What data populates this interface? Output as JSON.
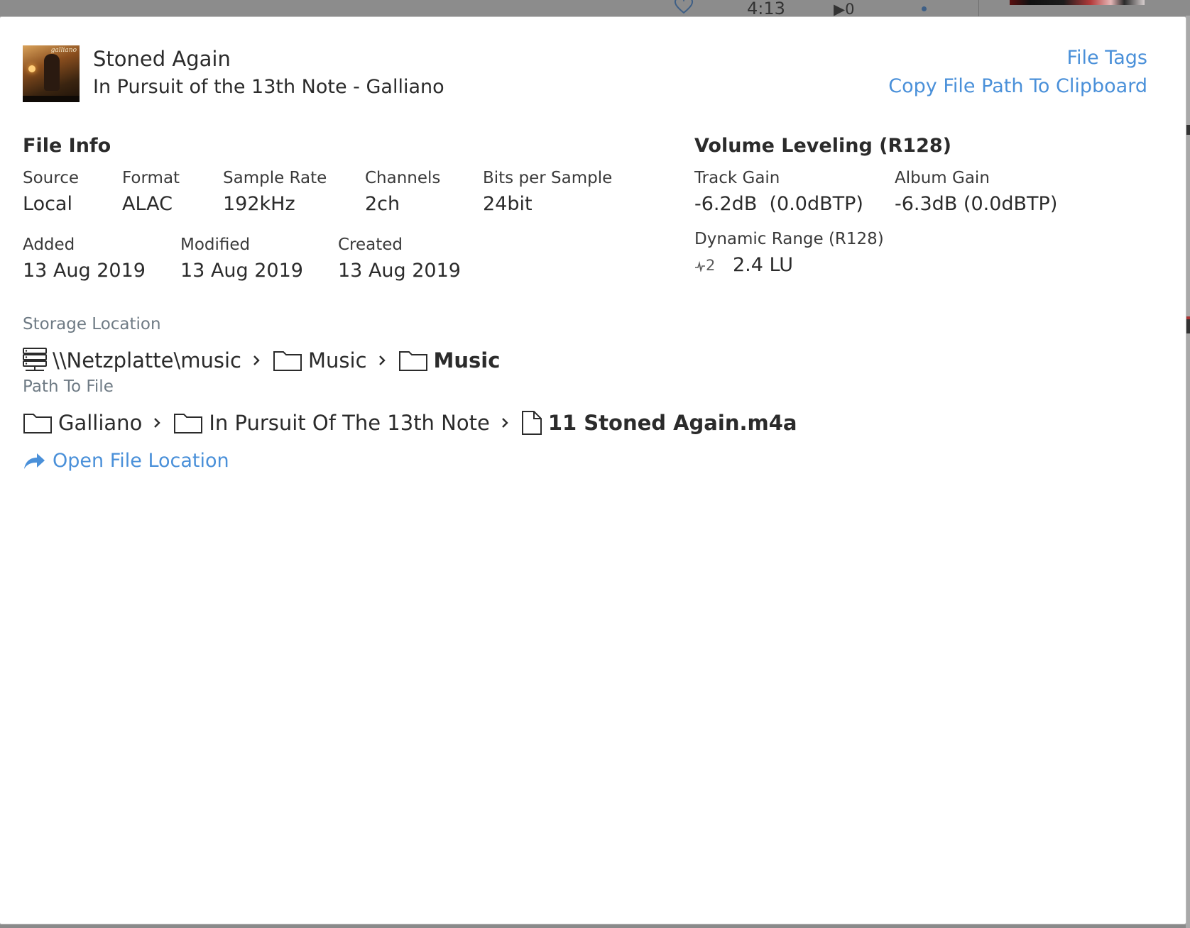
{
  "background_player": {
    "time": "4:13",
    "play_count": "0"
  },
  "header": {
    "title": "Stoned Again",
    "subtitle": "In Pursuit of the 13th Note - Galliano",
    "cover_logo": "galliano",
    "actions": {
      "file_tags": "File Tags",
      "copy_path": "Copy File Path To Clipboard"
    }
  },
  "file_info": {
    "title": "File Info",
    "source_label": "Source",
    "source_value": "Local",
    "format_label": "Format",
    "format_value": "ALAC",
    "sample_rate_label": "Sample Rate",
    "sample_rate_value": "192kHz",
    "channels_label": "Channels",
    "channels_value": "2ch",
    "bits_label": "Bits per Sample",
    "bits_value": "24bit",
    "added_label": "Added",
    "added_value": "13 Aug 2019",
    "modified_label": "Modified",
    "modified_value": "13 Aug 2019",
    "created_label": "Created",
    "created_value": "13 Aug 2019"
  },
  "volume_leveling": {
    "title": "Volume Leveling (R128)",
    "track_gain_label": "Track Gain",
    "track_gain_value": "-6.2dB  (0.0dBTP)",
    "album_gain_label": "Album Gain",
    "album_gain_value": "-6.3dB (0.0dBTP)",
    "dynamic_range_label": "Dynamic Range (R128)",
    "dynamic_range_badge": "2",
    "dynamic_range_value": "2.4 LU"
  },
  "storage": {
    "label": "Storage Location",
    "crumbs": [
      "\\\\Netzplatte\\music",
      "Music",
      "Music"
    ]
  },
  "path": {
    "label": "Path To File",
    "crumbs": [
      "Galliano",
      "In Pursuit Of The 13th Note",
      "11 Stoned Again.m4a"
    ]
  },
  "open_location": "Open File Location",
  "colors": {
    "link": "#4a90d9",
    "text": "#2b2b2b",
    "muted_label": "#6f7b85"
  }
}
